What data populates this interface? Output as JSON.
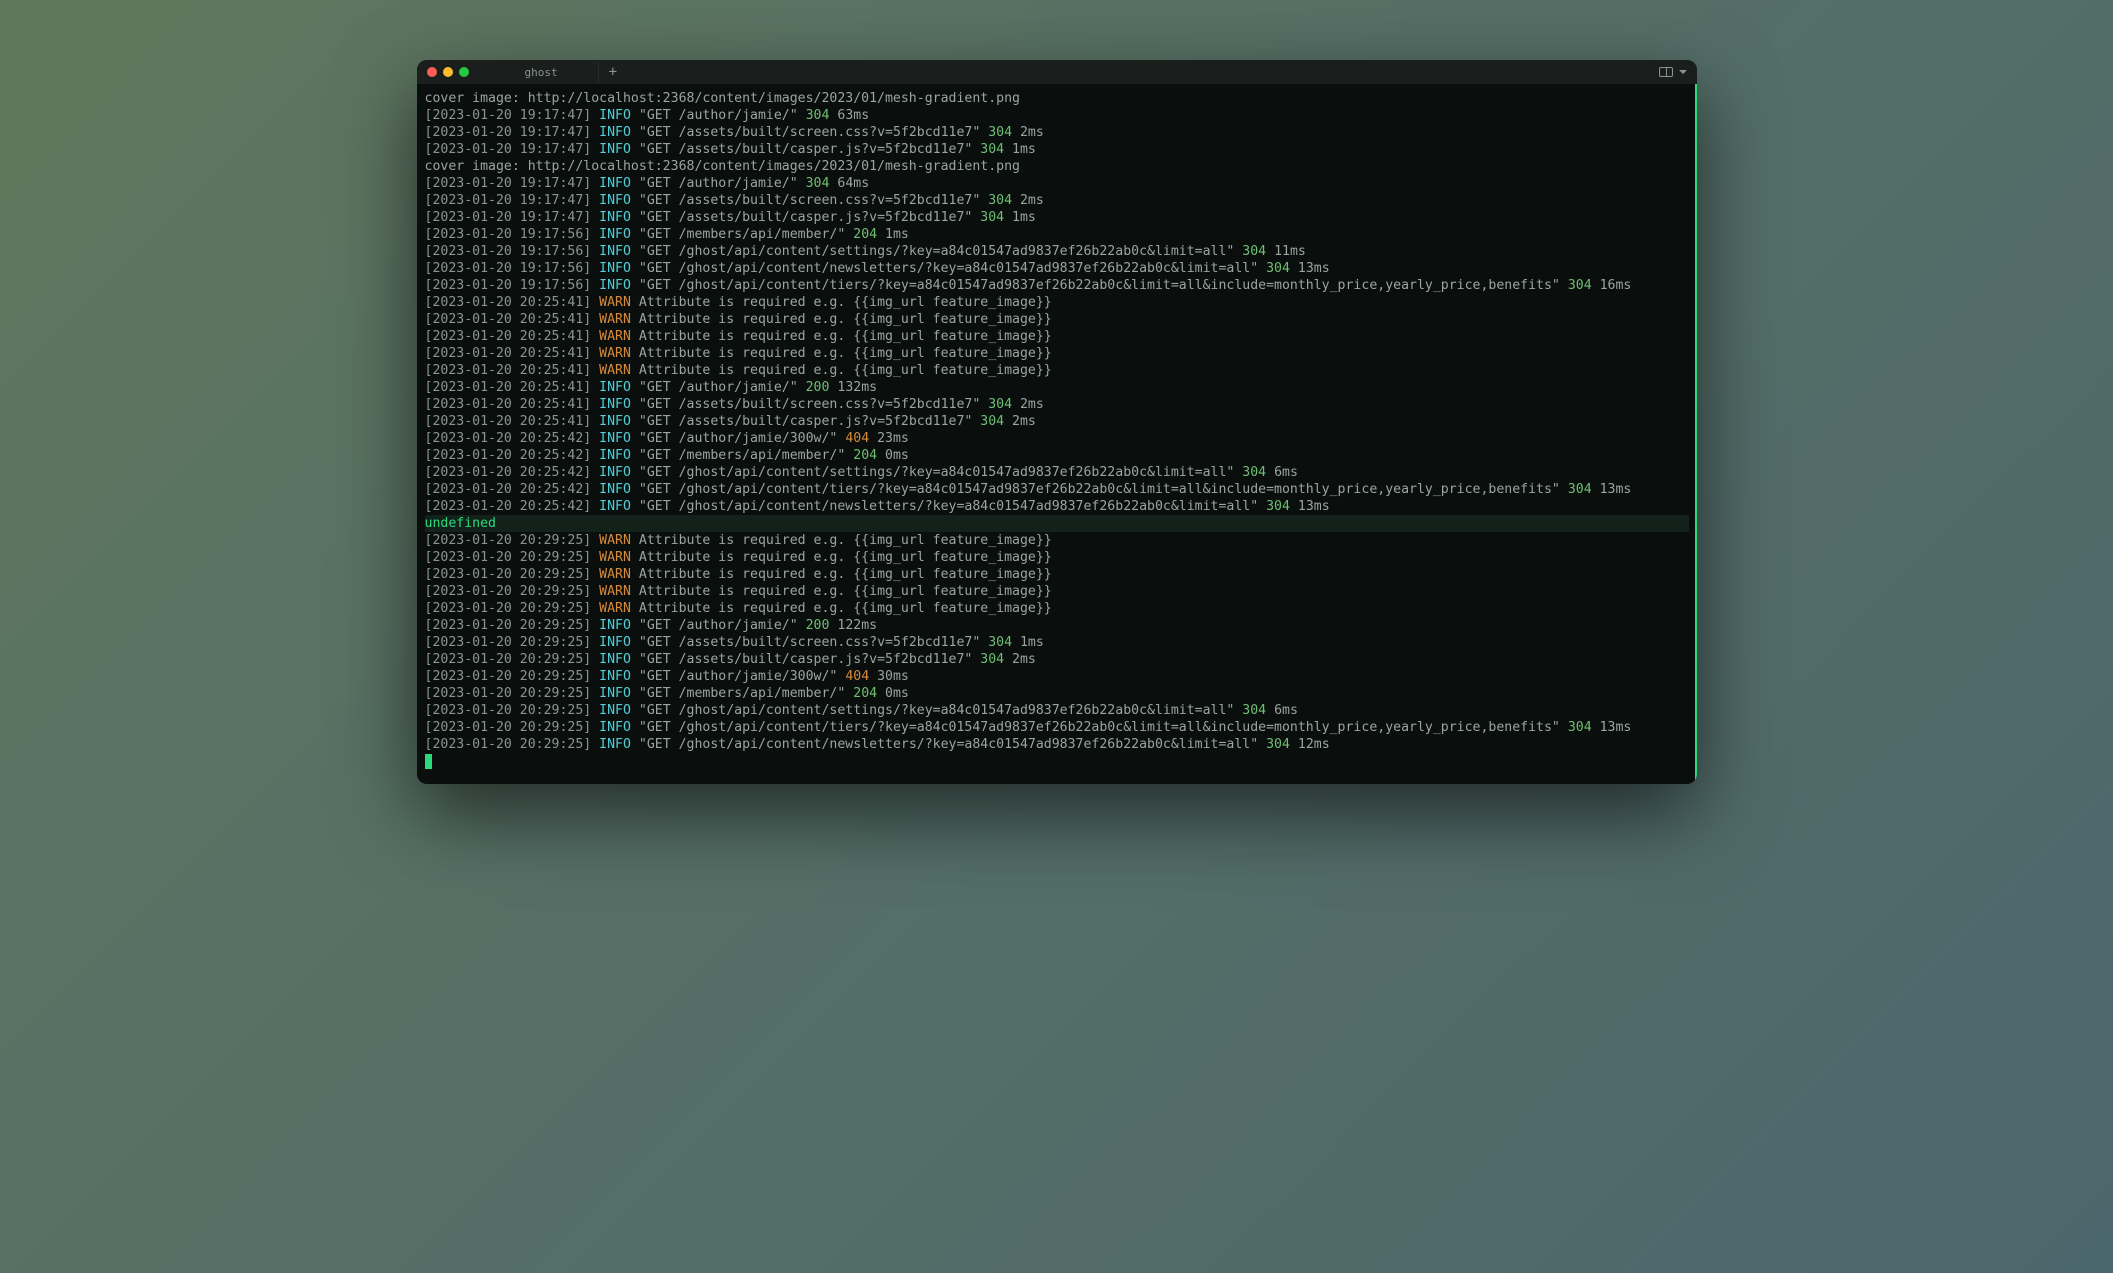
{
  "titlebar": {
    "tab_title": "ghost",
    "new_tab": "+"
  },
  "lines": [
    {
      "type": "plain",
      "text": "cover image: http://localhost:2368/content/images/2023/01/mesh-gradient.png"
    },
    {
      "type": "log",
      "ts": "[2023-01-20 19:17:47]",
      "level": "INFO",
      "req": "\"GET /author/jamie/\"",
      "status": "304",
      "dur": "63ms"
    },
    {
      "type": "log",
      "ts": "[2023-01-20 19:17:47]",
      "level": "INFO",
      "req": "\"GET /assets/built/screen.css?v=5f2bcd11e7\"",
      "status": "304",
      "dur": "2ms"
    },
    {
      "type": "log",
      "ts": "[2023-01-20 19:17:47]",
      "level": "INFO",
      "req": "\"GET /assets/built/casper.js?v=5f2bcd11e7\"",
      "status": "304",
      "dur": "1ms"
    },
    {
      "type": "plain",
      "text": "cover image: http://localhost:2368/content/images/2023/01/mesh-gradient.png"
    },
    {
      "type": "log",
      "ts": "[2023-01-20 19:17:47]",
      "level": "INFO",
      "req": "\"GET /author/jamie/\"",
      "status": "304",
      "dur": "64ms"
    },
    {
      "type": "log",
      "ts": "[2023-01-20 19:17:47]",
      "level": "INFO",
      "req": "\"GET /assets/built/screen.css?v=5f2bcd11e7\"",
      "status": "304",
      "dur": "2ms"
    },
    {
      "type": "log",
      "ts": "[2023-01-20 19:17:47]",
      "level": "INFO",
      "req": "\"GET /assets/built/casper.js?v=5f2bcd11e7\"",
      "status": "304",
      "dur": "1ms"
    },
    {
      "type": "log",
      "ts": "[2023-01-20 19:17:56]",
      "level": "INFO",
      "req": "\"GET /members/api/member/\"",
      "status": "204",
      "dur": "1ms"
    },
    {
      "type": "log",
      "ts": "[2023-01-20 19:17:56]",
      "level": "INFO",
      "req": "\"GET /ghost/api/content/settings/?key=a84c01547ad9837ef26b22ab0c&limit=all\"",
      "status": "304",
      "dur": "11ms"
    },
    {
      "type": "log",
      "ts": "[2023-01-20 19:17:56]",
      "level": "INFO",
      "req": "\"GET /ghost/api/content/newsletters/?key=a84c01547ad9837ef26b22ab0c&limit=all\"",
      "status": "304",
      "dur": "13ms"
    },
    {
      "type": "log",
      "ts": "[2023-01-20 19:17:56]",
      "level": "INFO",
      "req": "\"GET /ghost/api/content/tiers/?key=a84c01547ad9837ef26b22ab0c&limit=all&include=monthly_price,yearly_price,benefits\"",
      "status": "304",
      "dur": "16ms"
    },
    {
      "type": "warn",
      "ts": "[2023-01-20 20:25:41]",
      "level": "WARN",
      "msg": "Attribute is required e.g. {{img_url feature_image}}"
    },
    {
      "type": "warn",
      "ts": "[2023-01-20 20:25:41]",
      "level": "WARN",
      "msg": "Attribute is required e.g. {{img_url feature_image}}"
    },
    {
      "type": "warn",
      "ts": "[2023-01-20 20:25:41]",
      "level": "WARN",
      "msg": "Attribute is required e.g. {{img_url feature_image}}"
    },
    {
      "type": "warn",
      "ts": "[2023-01-20 20:25:41]",
      "level": "WARN",
      "msg": "Attribute is required e.g. {{img_url feature_image}}"
    },
    {
      "type": "warn",
      "ts": "[2023-01-20 20:25:41]",
      "level": "WARN",
      "msg": "Attribute is required e.g. {{img_url feature_image}}"
    },
    {
      "type": "log",
      "ts": "[2023-01-20 20:25:41]",
      "level": "INFO",
      "req": "\"GET /author/jamie/\"",
      "status": "200",
      "dur": "132ms"
    },
    {
      "type": "log",
      "ts": "[2023-01-20 20:25:41]",
      "level": "INFO",
      "req": "\"GET /assets/built/screen.css?v=5f2bcd11e7\"",
      "status": "304",
      "dur": "2ms"
    },
    {
      "type": "log",
      "ts": "[2023-01-20 20:25:41]",
      "level": "INFO",
      "req": "\"GET /assets/built/casper.js?v=5f2bcd11e7\"",
      "status": "304",
      "dur": "2ms"
    },
    {
      "type": "log",
      "ts": "[2023-01-20 20:25:42]",
      "level": "INFO",
      "req": "\"GET /author/jamie/300w/\"",
      "status": "404",
      "dur": "23ms"
    },
    {
      "type": "log",
      "ts": "[2023-01-20 20:25:42]",
      "level": "INFO",
      "req": "\"GET /members/api/member/\"",
      "status": "204",
      "dur": "0ms"
    },
    {
      "type": "log",
      "ts": "[2023-01-20 20:25:42]",
      "level": "INFO",
      "req": "\"GET /ghost/api/content/settings/?key=a84c01547ad9837ef26b22ab0c&limit=all\"",
      "status": "304",
      "dur": "6ms"
    },
    {
      "type": "log",
      "ts": "[2023-01-20 20:25:42]",
      "level": "INFO",
      "req": "\"GET /ghost/api/content/tiers/?key=a84c01547ad9837ef26b22ab0c&limit=all&include=monthly_price,yearly_price,benefits\"",
      "status": "304",
      "dur": "13ms"
    },
    {
      "type": "log",
      "ts": "[2023-01-20 20:25:42]",
      "level": "INFO",
      "req": "\"GET /ghost/api/content/newsletters/?key=a84c01547ad9837ef26b22ab0c&limit=all\"",
      "status": "304",
      "dur": "13ms"
    },
    {
      "type": "highlight",
      "text": "undefined"
    },
    {
      "type": "warn",
      "ts": "[2023-01-20 20:29:25]",
      "level": "WARN",
      "msg": "Attribute is required e.g. {{img_url feature_image}}"
    },
    {
      "type": "warn",
      "ts": "[2023-01-20 20:29:25]",
      "level": "WARN",
      "msg": "Attribute is required e.g. {{img_url feature_image}}"
    },
    {
      "type": "warn",
      "ts": "[2023-01-20 20:29:25]",
      "level": "WARN",
      "msg": "Attribute is required e.g. {{img_url feature_image}}"
    },
    {
      "type": "warn",
      "ts": "[2023-01-20 20:29:25]",
      "level": "WARN",
      "msg": "Attribute is required e.g. {{img_url feature_image}}"
    },
    {
      "type": "warn",
      "ts": "[2023-01-20 20:29:25]",
      "level": "WARN",
      "msg": "Attribute is required e.g. {{img_url feature_image}}"
    },
    {
      "type": "log",
      "ts": "[2023-01-20 20:29:25]",
      "level": "INFO",
      "req": "\"GET /author/jamie/\"",
      "status": "200",
      "dur": "122ms"
    },
    {
      "type": "log",
      "ts": "[2023-01-20 20:29:25]",
      "level": "INFO",
      "req": "\"GET /assets/built/screen.css?v=5f2bcd11e7\"",
      "status": "304",
      "dur": "1ms"
    },
    {
      "type": "log",
      "ts": "[2023-01-20 20:29:25]",
      "level": "INFO",
      "req": "\"GET /assets/built/casper.js?v=5f2bcd11e7\"",
      "status": "304",
      "dur": "2ms"
    },
    {
      "type": "log",
      "ts": "[2023-01-20 20:29:25]",
      "level": "INFO",
      "req": "\"GET /author/jamie/300w/\"",
      "status": "404",
      "dur": "30ms"
    },
    {
      "type": "log",
      "ts": "[2023-01-20 20:29:25]",
      "level": "INFO",
      "req": "\"GET /members/api/member/\"",
      "status": "204",
      "dur": "0ms"
    },
    {
      "type": "log",
      "ts": "[2023-01-20 20:29:25]",
      "level": "INFO",
      "req": "\"GET /ghost/api/content/settings/?key=a84c01547ad9837ef26b22ab0c&limit=all\"",
      "status": "304",
      "dur": "6ms"
    },
    {
      "type": "log",
      "ts": "[2023-01-20 20:29:25]",
      "level": "INFO",
      "req": "\"GET /ghost/api/content/tiers/?key=a84c01547ad9837ef26b22ab0c&limit=all&include=monthly_price,yearly_price,benefits\"",
      "status": "304",
      "dur": "13ms"
    },
    {
      "type": "log",
      "ts": "[2023-01-20 20:29:25]",
      "level": "INFO",
      "req": "\"GET /ghost/api/content/newsletters/?key=a84c01547ad9837ef26b22ab0c&limit=all\"",
      "status": "304",
      "dur": "12ms"
    }
  ]
}
